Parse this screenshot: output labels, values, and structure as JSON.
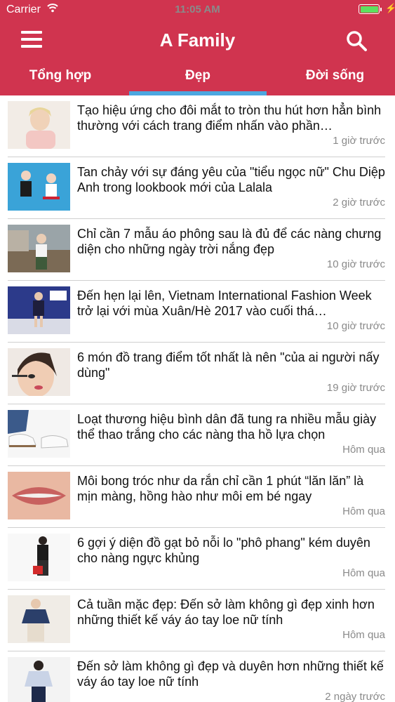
{
  "status_bar": {
    "carrier": "Carrier",
    "time": "11:05 AM"
  },
  "header": {
    "title": "A Family"
  },
  "tabs": [
    {
      "label": "Tổng hợp",
      "active": false
    },
    {
      "label": "Đẹp",
      "active": true
    },
    {
      "label": "Đời sống",
      "active": false
    }
  ],
  "colors": {
    "header": "#d0344f",
    "tab_indicator": "#4ca7e0",
    "battery": "#5ee05f"
  },
  "articles": [
    {
      "title": "Tạo hiệu ứng cho đôi mắt to tròn thu hút hơn hẳn bình thường với cách trang điểm nhấn vào phần…",
      "time": "1 giờ trước"
    },
    {
      "title": "Tan chảy với sự đáng yêu của \"tiểu ngọc nữ\" Chu Diệp Anh trong lookbook mới của Lalala",
      "time": "2 giờ trước"
    },
    {
      "title": "Chỉ cần 7 mẫu áo phông sau là đủ để các nàng chưng diện cho những ngày trời nắng đẹp",
      "time": "10 giờ trước"
    },
    {
      "title": "Đến hẹn lại lên, Vietnam International Fashion Week trở lại với mùa Xuân/Hè 2017 vào cuối thá…",
      "time": "10 giờ trước"
    },
    {
      "title": "6 món đồ trang điểm tốt nhất là nên \"của ai người nấy dùng\"",
      "time": "19 giờ trước"
    },
    {
      "title": "Loạt thương hiệu bình dân đã tung ra nhiều mẫu giày thể thao trắng cho các nàng tha hồ lựa chọn",
      "time": "Hôm qua"
    },
    {
      "title": "Môi bong tróc như da rắn chỉ cần 1 phút “lăn lăn” là mịn màng, hồng hào như môi em bé ngay",
      "time": "Hôm qua"
    },
    {
      "title": "6 gợi ý diện đồ gạt bỏ nỗi lo \"phô phang\" kém duyên cho nàng ngực khủng",
      "time": "Hôm qua"
    },
    {
      "title": "Cả tuần mặc đẹp: Đến sở làm không gì đẹp xinh hơn những thiết kế váy áo tay loe nữ tính",
      "time": "Hôm qua"
    },
    {
      "title": "Đến sở làm không gì đẹp và duyên hơn những thiết kế váy áo tay loe nữ tính",
      "time": "2 ngày trước"
    }
  ]
}
